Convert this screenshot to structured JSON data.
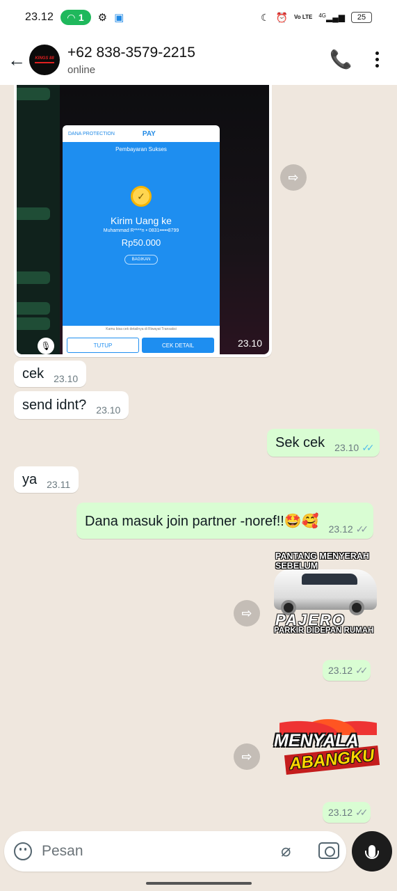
{
  "status_bar": {
    "time": "23.12",
    "hotspot_count": "1",
    "volte": "Vo LTE",
    "network": "4G",
    "battery": "25"
  },
  "header": {
    "contact_name": "+62 838-3579-2215",
    "contact_status": "online",
    "avatar_logo_text": "KINGS 88"
  },
  "image_message": {
    "time": "23.10",
    "dana": {
      "brand": "DANA PROTECTION",
      "pay_label": "PAY",
      "status": "Pembayaran Sukses",
      "headline": "Kirim Uang ke",
      "recipient": "Muhammad R****n • 0831•••••8799",
      "amount": "Rp50.000",
      "share_label": "BAGIKAN",
      "footer_note": "Kamu bisa cek detailnya di Riwayat Transaksi",
      "close_label": "TUTUP",
      "detail_label": "CEK DETAIL"
    }
  },
  "messages": [
    {
      "id": "m1",
      "direction": "in",
      "text": "cek",
      "time": "23.10"
    },
    {
      "id": "m2",
      "direction": "in",
      "text": "send idnt?",
      "time": "23.10"
    },
    {
      "id": "m3",
      "direction": "out",
      "text": "Sek cek",
      "time": "23.10",
      "status": "read"
    },
    {
      "id": "m4",
      "direction": "in",
      "text": "ya",
      "time": "23.11"
    },
    {
      "id": "m5",
      "direction": "out",
      "text": "Dana masuk join partner -noref!!🤩🥰",
      "time": "23.12",
      "status": "delivered"
    }
  ],
  "stickers": [
    {
      "id": "s1",
      "top_text": "PANTANG MENYERAH",
      "top_text_2": "SEBELUM",
      "brand_text": "PAJERO",
      "bottom_text": "PARKIR DIDEPAN RUMAH",
      "time": "23.12",
      "status": "delivered"
    },
    {
      "id": "s2",
      "line1": "MENYALA",
      "line2": "ABANGKU",
      "time": "23.12",
      "status": "delivered"
    }
  ],
  "composer": {
    "placeholder": "Pesan"
  },
  "colors": {
    "outgoing_bubble": "#d9fdd3",
    "incoming_bubble": "#ffffff",
    "chat_background": "#efe7de",
    "read_ticks": "#53bdeb",
    "hotspot_badge": "#1fb85c",
    "dana_blue": "#1e8ef0"
  },
  "icons": [
    "back-arrow-icon",
    "add-call-icon",
    "more-vert-icon",
    "forward-icon",
    "emoji-icon",
    "attach-icon",
    "camera-icon",
    "mic-icon"
  ]
}
